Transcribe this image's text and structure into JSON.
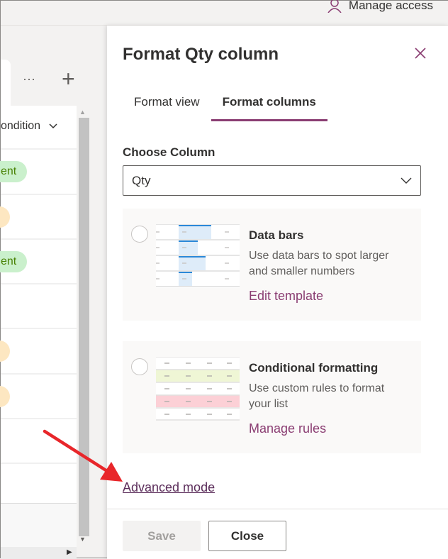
{
  "topbar": {
    "manage_access": "Manage access"
  },
  "list": {
    "header": "ondition",
    "pills": [
      {
        "text": "ent",
        "kind": "green"
      },
      {
        "text": "",
        "kind": "yellow"
      },
      {
        "text": "ent",
        "kind": "green"
      },
      {
        "text": "",
        "kind": "none"
      },
      {
        "text": "",
        "kind": "yellow"
      },
      {
        "text": "",
        "kind": "yellow"
      },
      {
        "text": "",
        "kind": "none"
      },
      {
        "text": "",
        "kind": "none"
      }
    ],
    "more": "···",
    "add": "+"
  },
  "panel": {
    "title": "Format Qty column",
    "tabs": [
      {
        "label": "Format view",
        "active": false
      },
      {
        "label": "Format columns",
        "active": true
      }
    ],
    "choose_label": "Choose Column",
    "column_value": "Qty",
    "cards": [
      {
        "title": "Data bars",
        "desc": "Use data bars to spot larger and smaller numbers",
        "link": "Edit template"
      },
      {
        "title": "Conditional formatting",
        "desc": "Use custom rules to format your list",
        "link": "Manage rules"
      }
    ],
    "advanced": "Advanced mode",
    "save": "Save",
    "close": "Close"
  },
  "colors": {
    "accent": "#8a3d72",
    "annotation_arrow": "#e8262a"
  }
}
